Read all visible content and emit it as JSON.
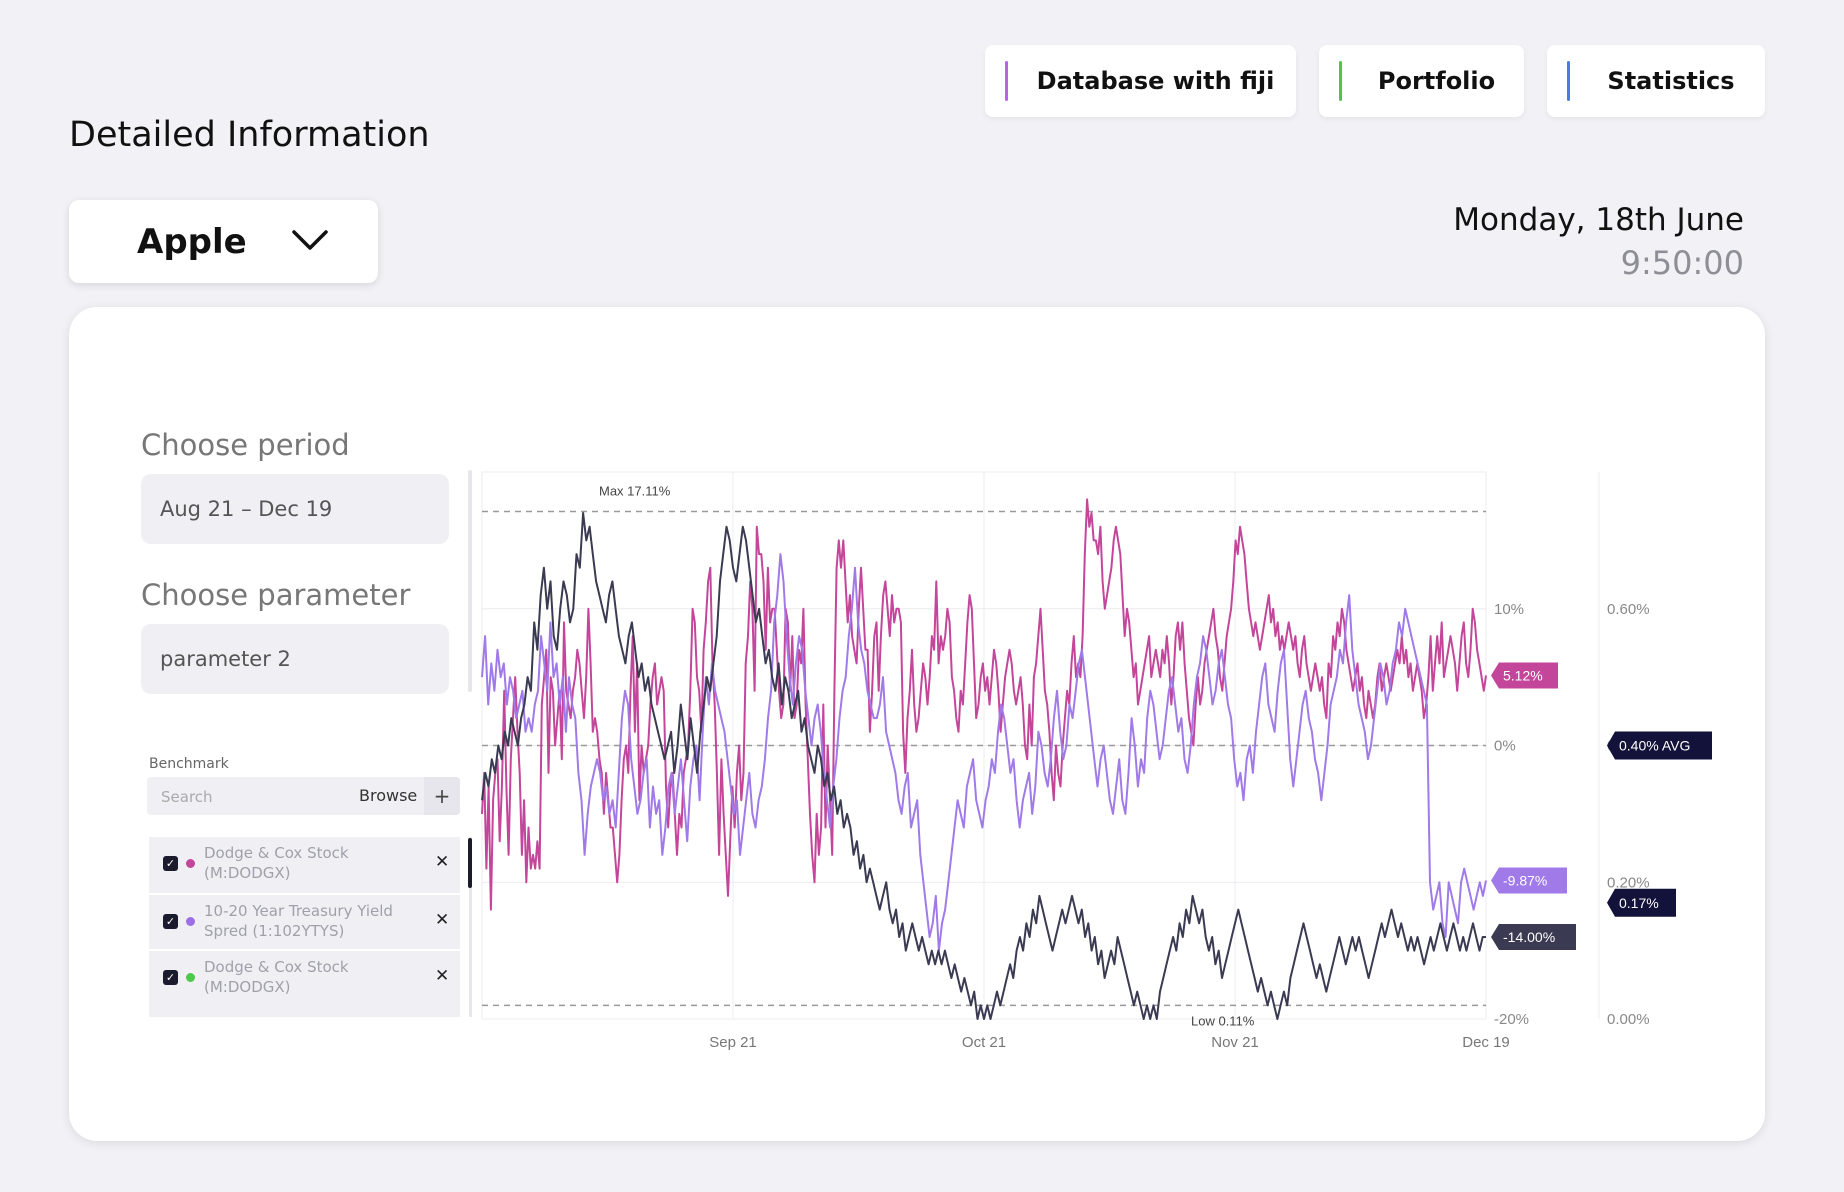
{
  "header": {
    "title": "Detailed Information",
    "nav": [
      {
        "label": "Database with fiji",
        "accent": "#b565e6"
      },
      {
        "label": "Portfolio",
        "accent": "#4cc84a"
      },
      {
        "label": "Statistics",
        "accent": "#4a7ae8"
      }
    ],
    "company": "Apple",
    "date": "Monday, 18th June",
    "time": "9:50:00"
  },
  "filters": {
    "period_label": "Choose period",
    "period_value": "Aug 21 – Dec 19",
    "parameter_label": "Choose parameter",
    "parameter_value": "parameter 2"
  },
  "benchmark": {
    "label": "Benchmark",
    "search_placeholder": "Search",
    "browse_label": "Browse",
    "items": [
      {
        "name": "Dodge & Cox Stock (M:DODGX)",
        "color": "#c4469a",
        "checked": true
      },
      {
        "name": "10-20 Year Treasury Yield Spred (1:102YTYS)",
        "color": "#9c6fe6",
        "checked": true
      },
      {
        "name": "Dodge & Cox Stock (M:DODGX)",
        "color": "#4cc84a",
        "checked": true
      }
    ]
  },
  "chart_data": {
    "type": "line",
    "x_ticks": [
      "Sep 21",
      "Oct 21",
      "Nov 21",
      "Dec 19"
    ],
    "y_ticks": [
      "10%",
      "0%",
      "-10%",
      "-20%"
    ],
    "y_range": [
      -20,
      20
    ],
    "y2_ticks": [
      "0.60%",
      "0.40%",
      "0.20%",
      "0.00%"
    ],
    "y2_range": [
      0,
      0.8
    ],
    "grid": true,
    "series": [
      {
        "color": "#c4469a",
        "end_label": "5.12%",
        "values": [
          -5,
          -2,
          -9,
          -3,
          -12,
          -4,
          -2,
          -1,
          -7,
          -3,
          4,
          -3,
          -8,
          -1,
          2,
          5,
          1,
          -2,
          -8,
          -4,
          -10,
          -6,
          -9,
          -8,
          -9,
          -7,
          -9,
          3,
          5,
          7,
          -2,
          5,
          4,
          0,
          2,
          4,
          -1,
          9,
          4,
          3,
          2,
          4,
          5,
          7,
          6,
          4,
          2,
          5,
          10,
          6,
          1,
          2,
          1,
          -1,
          -2,
          -5,
          -2,
          -4,
          -6,
          -6,
          -8,
          -10,
          -8,
          -4,
          -1,
          0,
          -2,
          4,
          8,
          1,
          6,
          -4,
          0,
          -2,
          -1,
          0,
          3,
          5,
          6,
          3,
          4,
          5,
          4,
          -3,
          -6,
          -3,
          -2,
          -5,
          -8,
          -5,
          -6,
          -2,
          -1,
          0,
          4,
          10,
          9,
          5,
          4,
          1,
          7,
          9,
          12,
          13,
          6,
          3,
          -2,
          -8,
          -1,
          -5,
          -8,
          -11,
          -7,
          -3,
          -6,
          -2,
          0,
          -4,
          -2,
          6,
          8,
          12,
          10,
          4,
          16,
          14,
          14,
          12,
          7,
          13,
          9,
          10,
          10,
          7,
          4,
          2,
          3,
          10,
          9,
          4,
          8,
          2,
          3,
          7,
          6,
          10,
          3,
          -1,
          -5,
          -8,
          -10,
          -5,
          -8,
          -6,
          3,
          -6,
          0,
          -4,
          -8,
          4,
          13,
          15,
          13,
          15,
          12,
          9,
          11,
          8,
          7,
          6,
          10,
          13,
          10,
          7,
          7,
          1,
          4,
          8,
          9,
          4,
          8,
          11,
          12,
          10,
          8,
          11,
          9,
          10,
          10,
          9,
          1,
          -2,
          2,
          4,
          7,
          3,
          1,
          2,
          4,
          6,
          5,
          3,
          5,
          8,
          7,
          12,
          6,
          8,
          7,
          8,
          10,
          9,
          5,
          4,
          2,
          1,
          4,
          3,
          6,
          9,
          11,
          10,
          6,
          2,
          3,
          5,
          6,
          4,
          5,
          3,
          5,
          7,
          6,
          4,
          1,
          3,
          5,
          6,
          7,
          6,
          4,
          3,
          4,
          5,
          3,
          0,
          -1,
          3,
          0,
          5,
          6,
          8,
          10,
          7,
          4,
          3,
          1,
          -2,
          -4,
          0,
          -2,
          -3,
          0,
          2,
          4,
          3,
          6,
          8,
          5,
          6,
          5,
          8,
          14,
          18,
          16,
          17,
          15,
          15,
          14,
          16,
          12,
          10,
          11,
          12,
          13,
          15,
          16,
          15,
          14,
          11,
          8,
          10,
          9,
          7,
          5,
          6,
          3,
          4,
          5,
          6,
          7,
          8,
          5,
          6,
          7,
          6,
          5,
          7,
          6,
          8,
          6,
          3,
          5,
          8,
          9,
          7,
          9,
          6,
          4,
          2,
          1,
          0,
          3,
          5,
          3,
          4,
          6,
          7,
          8,
          9,
          10,
          8,
          7,
          5,
          4,
          6,
          8,
          9,
          10,
          12,
          15,
          14,
          16,
          15,
          14,
          12,
          10,
          9,
          8,
          9,
          8,
          7,
          8,
          9,
          10,
          11,
          9,
          10,
          8,
          9,
          7,
          8,
          7,
          8,
          9,
          8,
          7,
          8,
          6,
          5,
          7,
          8,
          6,
          5,
          4,
          5,
          6,
          5,
          4,
          5,
          3,
          2,
          6,
          5,
          8,
          7,
          9,
          8,
          10,
          9,
          7,
          6,
          5,
          4,
          5,
          6,
          4,
          5,
          3,
          2,
          4,
          3,
          2,
          3,
          5,
          6,
          4,
          5,
          6,
          5,
          4,
          5,
          6,
          7,
          6,
          8,
          6,
          7,
          5,
          6,
          4,
          5,
          6,
          5,
          4,
          2,
          3,
          5,
          8,
          4,
          6,
          8,
          6,
          9,
          5,
          6,
          7,
          8,
          7,
          6,
          4,
          6,
          8,
          9,
          6,
          5,
          7,
          10,
          9,
          7,
          6,
          5,
          4,
          5.12
        ]
      },
      {
        "color": "#a07ae8",
        "end_label": "-9.87%",
        "values": [
          5,
          8,
          3,
          6,
          4,
          7,
          5,
          6,
          3,
          5,
          4,
          2,
          3,
          4,
          1,
          2,
          1,
          3,
          4,
          8,
          6,
          4,
          9,
          5,
          6,
          3,
          5,
          1,
          5,
          3,
          2,
          -2,
          -4,
          -8,
          -5,
          -3,
          -2,
          -1,
          -2,
          -4,
          -3,
          -5,
          -4,
          -6,
          -2,
          2,
          4,
          3,
          -1,
          -3,
          -5,
          -4,
          -2,
          -1,
          -6,
          -3,
          -5,
          -4,
          -8,
          -6,
          -3,
          -2,
          -5,
          -3,
          -1,
          -4,
          -7,
          -3,
          -1,
          0,
          -4,
          1,
          5,
          3,
          6,
          4,
          3,
          2,
          1,
          -1,
          -3,
          -5,
          -4,
          -8,
          -6,
          -4,
          -2,
          -5,
          -6,
          -4,
          -3,
          -1,
          2,
          4,
          9,
          11,
          14,
          12,
          8,
          5,
          3,
          6,
          8,
          7,
          4,
          2,
          0,
          2,
          3,
          1,
          -2,
          -4,
          -6,
          -3,
          -1,
          2,
          4,
          5,
          8,
          10,
          13,
          9,
          7,
          6,
          4,
          3,
          2,
          2,
          3,
          5,
          1,
          0,
          -1,
          -2,
          -4,
          -5,
          -3,
          -2,
          -6,
          -5,
          -4,
          -8,
          -10,
          -12,
          -14,
          -13,
          -11,
          -15,
          -13,
          -12,
          -10,
          -8,
          -6,
          -4,
          -5,
          -6,
          -3,
          -2,
          -1,
          -4,
          -5,
          -6,
          -4,
          -3,
          -1,
          -2,
          1,
          3,
          2,
          0,
          -2,
          -1,
          -4,
          -6,
          -4,
          -3,
          -2,
          -5,
          -3,
          1,
          0,
          -2,
          -3,
          -1,
          2,
          4,
          1,
          -1,
          0,
          3,
          2,
          4,
          6,
          7,
          5,
          3,
          1,
          -1,
          -3,
          -1,
          0,
          -2,
          -4,
          -5,
          -3,
          -1,
          -4,
          -5,
          -2,
          2,
          0,
          -3,
          -1,
          -2,
          2,
          4,
          3,
          1,
          -1,
          0,
          2,
          4,
          5,
          3,
          1,
          2,
          -1,
          -2,
          0,
          3,
          5,
          6,
          8,
          7,
          5,
          3,
          4,
          6,
          7,
          5,
          3,
          2,
          -1,
          -3,
          -2,
          -4,
          -1,
          0,
          -2,
          1,
          3,
          5,
          6,
          3,
          2,
          1,
          4,
          6,
          7,
          3,
          -1,
          -3,
          -1,
          1,
          3,
          4,
          2,
          1,
          -1,
          -2,
          -4,
          -2,
          0,
          3,
          4,
          5,
          7,
          6,
          9,
          11,
          7,
          5,
          3,
          2,
          1,
          -1,
          0,
          2,
          4,
          6,
          5,
          3,
          4,
          6,
          7,
          9,
          8,
          10,
          9,
          8,
          7,
          6,
          5,
          4,
          3,
          -10,
          -12,
          -11,
          -10,
          -13,
          -14,
          -10,
          -11,
          -12,
          -13,
          -10,
          -9,
          -10,
          -11,
          -12,
          -11,
          -10,
          -11,
          -9.87
        ]
      },
      {
        "color": "#3a3a52",
        "end_label": "-14.00%",
        "values": [
          -4,
          -2,
          -3,
          -1,
          -2,
          0,
          -1,
          1,
          0,
          2,
          1,
          0,
          2,
          3,
          5,
          4,
          9,
          7,
          11,
          13,
          10,
          12,
          8,
          7,
          10,
          12,
          11,
          9,
          10,
          14,
          13,
          17,
          15,
          16,
          14,
          12,
          11,
          10,
          9,
          11,
          12,
          10,
          8,
          7,
          6,
          8,
          9,
          7,
          5,
          6,
          4,
          5,
          3,
          2,
          1,
          0,
          -1,
          0,
          1,
          -2,
          0,
          3,
          1,
          -1,
          2,
          0,
          -2,
          1,
          3,
          5,
          4,
          6,
          8,
          12,
          14,
          16,
          15,
          13,
          12,
          14,
          16,
          15,
          13,
          11,
          9,
          10,
          8,
          6,
          7,
          5,
          4,
          6,
          3,
          5,
          4,
          2,
          3,
          4,
          1,
          2,
          0,
          -1,
          -2,
          0,
          -1,
          -3,
          -2,
          -4,
          -3,
          -5,
          -4,
          -6,
          -5,
          -6,
          -8,
          -7,
          -9,
          -8,
          -10,
          -9,
          -10,
          -11,
          -12,
          -11,
          -10,
          -12,
          -13,
          -12,
          -14,
          -13,
          -15,
          -14,
          -13,
          -14,
          -15,
          -14,
          -15,
          -16,
          -15,
          -16,
          -15,
          -16,
          -15,
          -16,
          -17,
          -16,
          -17,
          -18,
          -17,
          -18,
          -19,
          -18,
          -20,
          -19,
          -20,
          -19,
          -20,
          -19,
          -18,
          -19,
          -18,
          -17,
          -16,
          -17,
          -15,
          -14,
          -15,
          -13,
          -14,
          -12,
          -13,
          -11,
          -12,
          -13,
          -14,
          -15,
          -14,
          -13,
          -12,
          -13,
          -12,
          -11,
          -12,
          -13,
          -12,
          -14,
          -13,
          -15,
          -14,
          -16,
          -15,
          -17,
          -16,
          -15,
          -16,
          -14,
          -15,
          -16,
          -17,
          -18,
          -19,
          -18,
          -19,
          -20,
          -19,
          -20,
          -19,
          -20,
          -18,
          -17,
          -16,
          -15,
          -14,
          -15,
          -13,
          -14,
          -12,
          -13,
          -11,
          -12,
          -13,
          -12,
          -14,
          -15,
          -14,
          -16,
          -15,
          -17,
          -16,
          -15,
          -14,
          -13,
          -12,
          -13,
          -14,
          -15,
          -16,
          -17,
          -18,
          -17,
          -18,
          -19,
          -18,
          -19,
          -20,
          -19,
          -18,
          -19,
          -17,
          -16,
          -15,
          -14,
          -13,
          -14,
          -15,
          -16,
          -17,
          -16,
          -17,
          -18,
          -17,
          -16,
          -15,
          -14,
          -15,
          -16,
          -15,
          -14,
          -15,
          -14,
          -15,
          -16,
          -17,
          -16,
          -15,
          -14,
          -13,
          -14,
          -13,
          -12,
          -13,
          -14,
          -13,
          -14,
          -15,
          -14,
          -15,
          -14,
          -15,
          -16,
          -15,
          -14,
          -15,
          -14,
          -13,
          -14,
          -15,
          -14,
          -13,
          -14,
          -15,
          -14,
          -15,
          -14,
          -13,
          -14,
          -15,
          -14,
          -14.0
        ]
      }
    ],
    "annotations": {
      "max_label": "Max 17.11%",
      "low_label": "Low 0.11%",
      "max_value": 17.11,
      "avg_value": 0,
      "low_value": -19
    },
    "right_badges": [
      {
        "label": "0.40% AVG",
        "value": 0.4
      },
      {
        "label": "0.17%",
        "value": 0.17
      }
    ]
  }
}
